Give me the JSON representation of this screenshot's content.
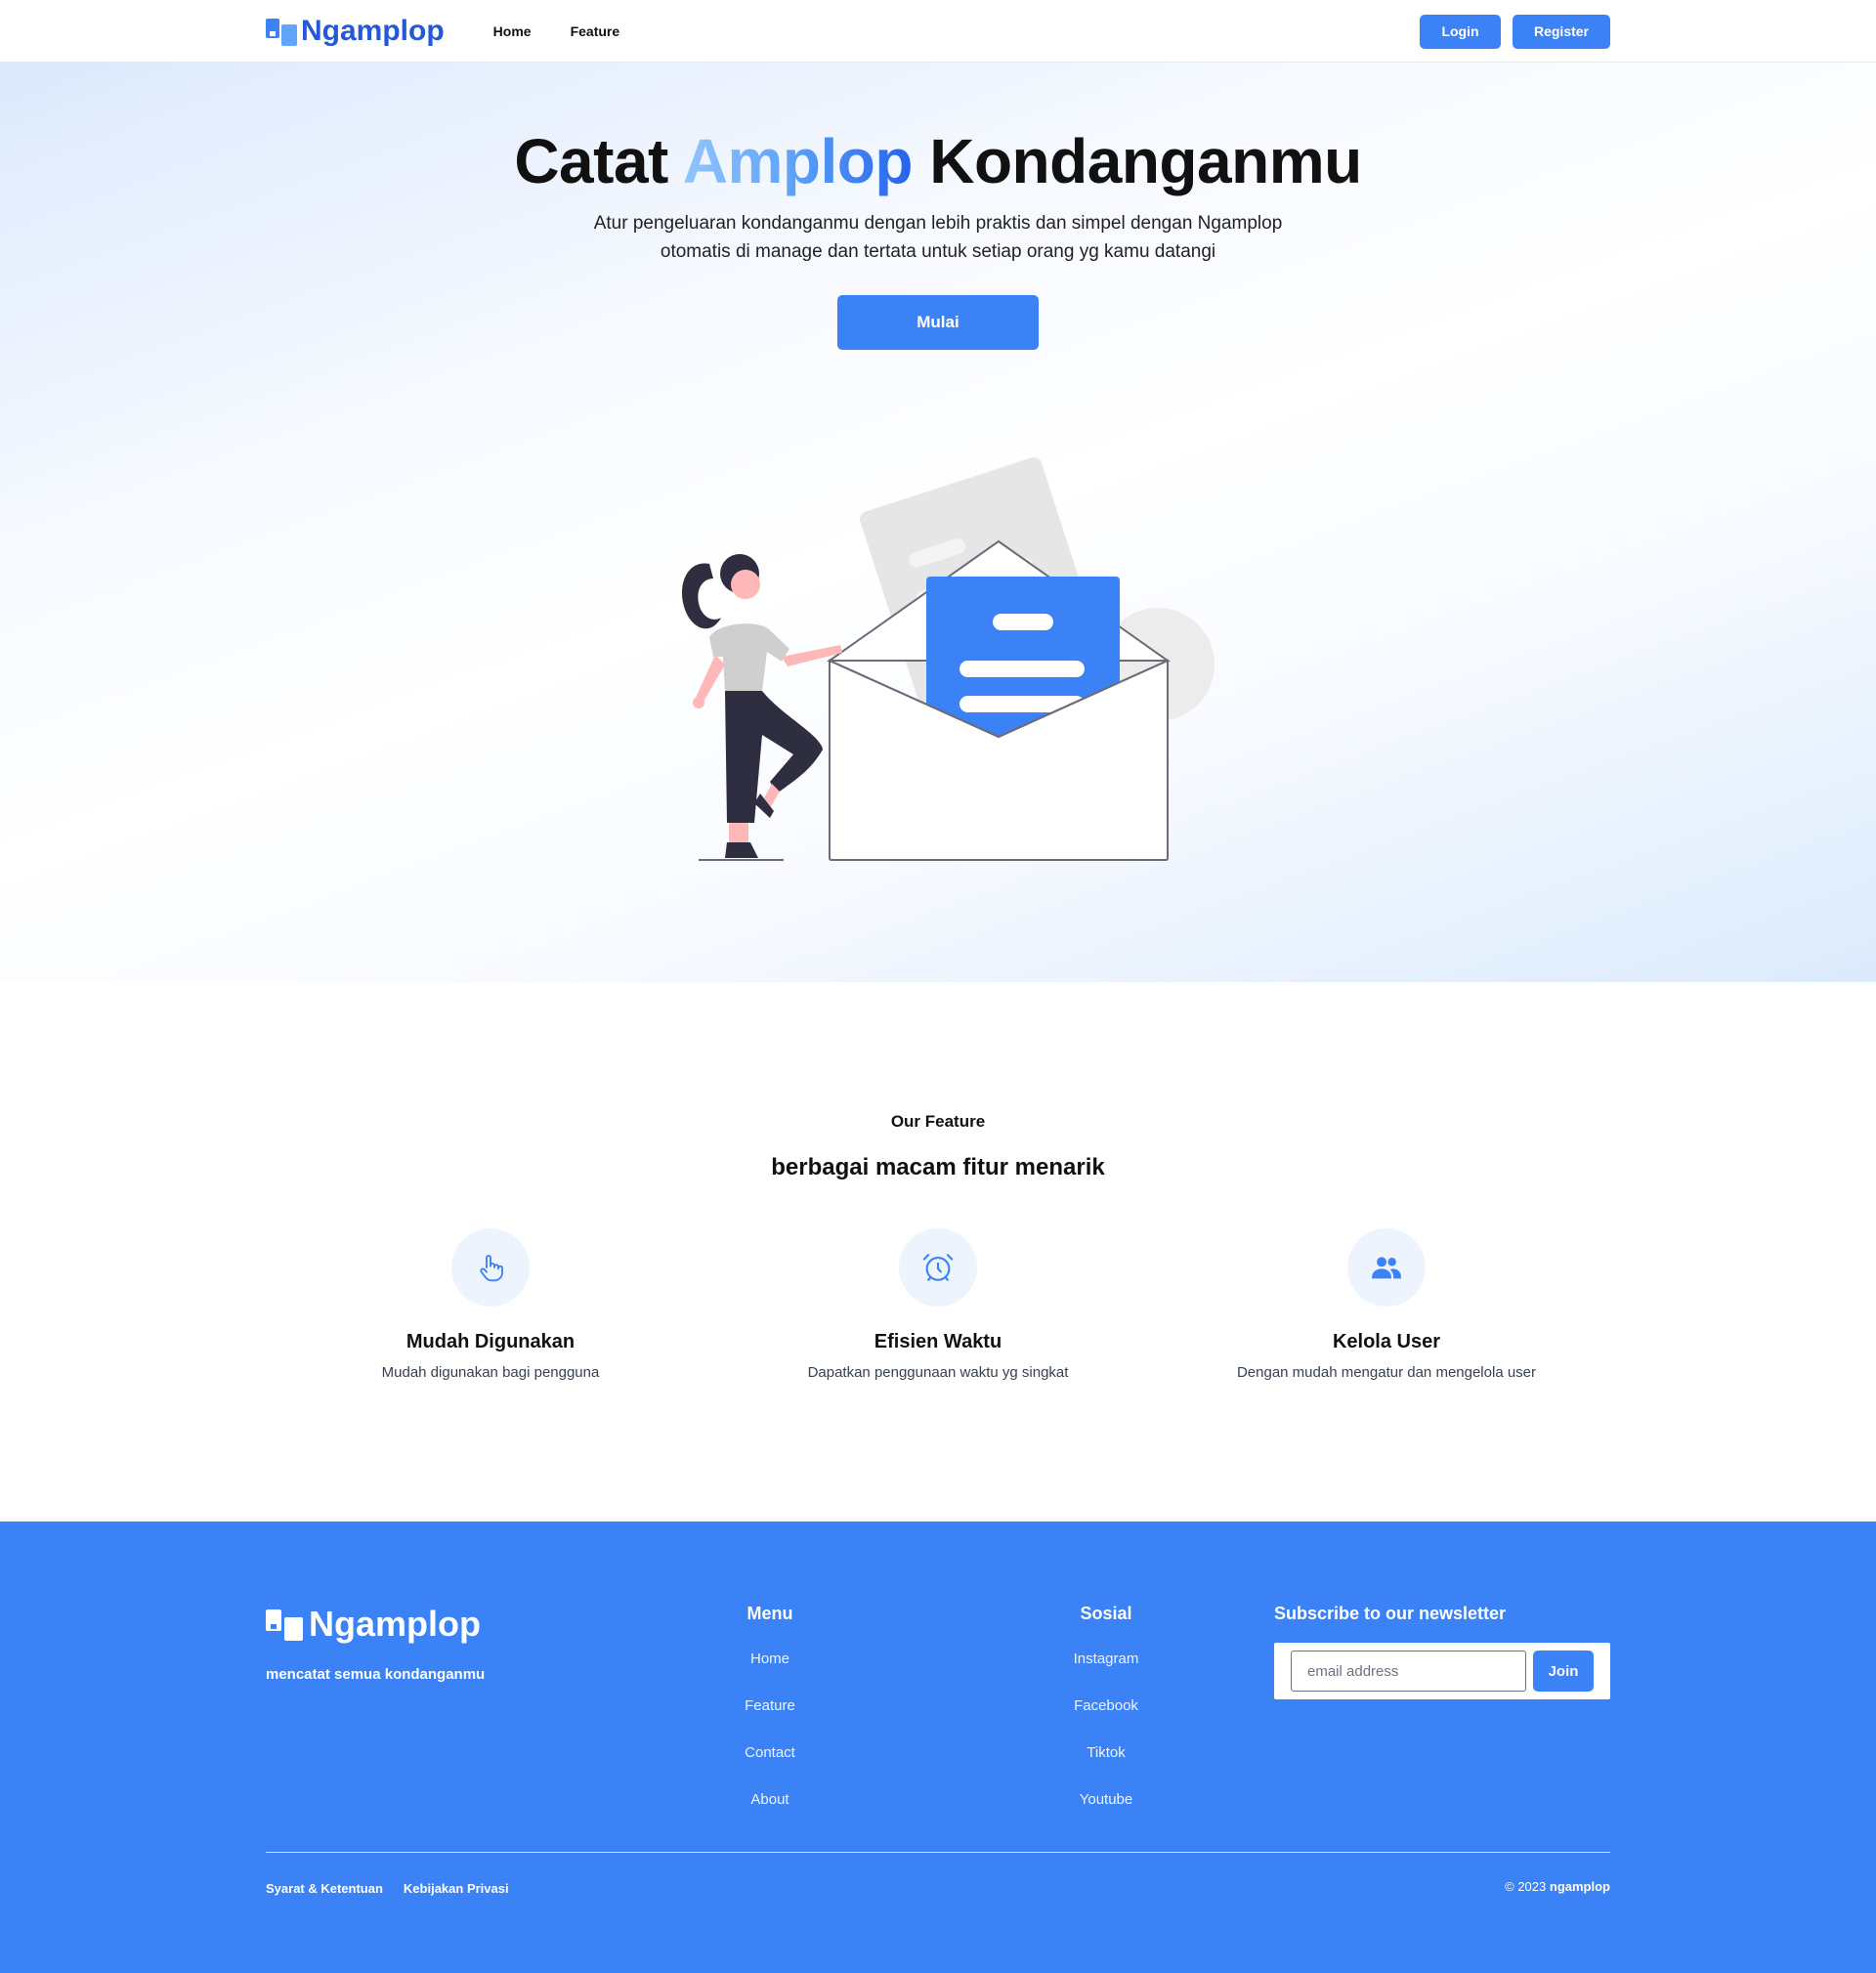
{
  "brand": {
    "name": "Ngamplop",
    "color": "#2557d6"
  },
  "nav": {
    "links": [
      "Home",
      "Feature"
    ],
    "login_label": "Login",
    "register_label": "Register"
  },
  "hero": {
    "title_part1": "Catat",
    "title_accent": "Amplop",
    "title_part2": "Kondanganmu",
    "subtitle_line1": "Atur pengeluaran kondanganmu dengan lebih praktis dan simpel dengan Ngamplop",
    "subtitle_line2": "otomatis di manage dan tertata untuk setiap orang yg kamu datangi",
    "cta_label": "Mulai",
    "illustration_icon": "woman-with-envelope-illustration"
  },
  "features": {
    "kicker": "Our Feature",
    "title": "berbagai macam fitur menarik",
    "items": [
      {
        "icon": "pointer-hand-icon",
        "title": "Mudah Digunakan",
        "desc": "Mudah digunakan bagi pengguna"
      },
      {
        "icon": "alarm-clock-icon",
        "title": "Efisien Waktu",
        "desc": "Dapatkan penggunaan waktu yg singkat"
      },
      {
        "icon": "users-icon",
        "title": "Kelola User",
        "desc": "Dengan mudah mengatur dan mengelola user"
      }
    ]
  },
  "footer": {
    "brand": "Ngamplop",
    "tagline": "mencatat semua kondanganmu",
    "menu": {
      "title": "Menu",
      "links": [
        "Home",
        "Feature",
        "Contact",
        "About"
      ]
    },
    "social": {
      "title": "Sosial",
      "links": [
        "Instagram",
        "Facebook",
        "Tiktok",
        "Youtube"
      ]
    },
    "newsletter": {
      "title": "Subscribe to our newsletter",
      "placeholder": "email address",
      "button_label": "Join"
    },
    "legal": [
      "Syarat & Ketentuan",
      "Kebijakan Privasi"
    ],
    "copyright_prefix": "© 2023",
    "copyright_name": "ngamplop"
  },
  "colors": {
    "primary": "#3b82f6",
    "accent_blue": "#60a5fa",
    "footer_bg": "#3b82f6"
  }
}
